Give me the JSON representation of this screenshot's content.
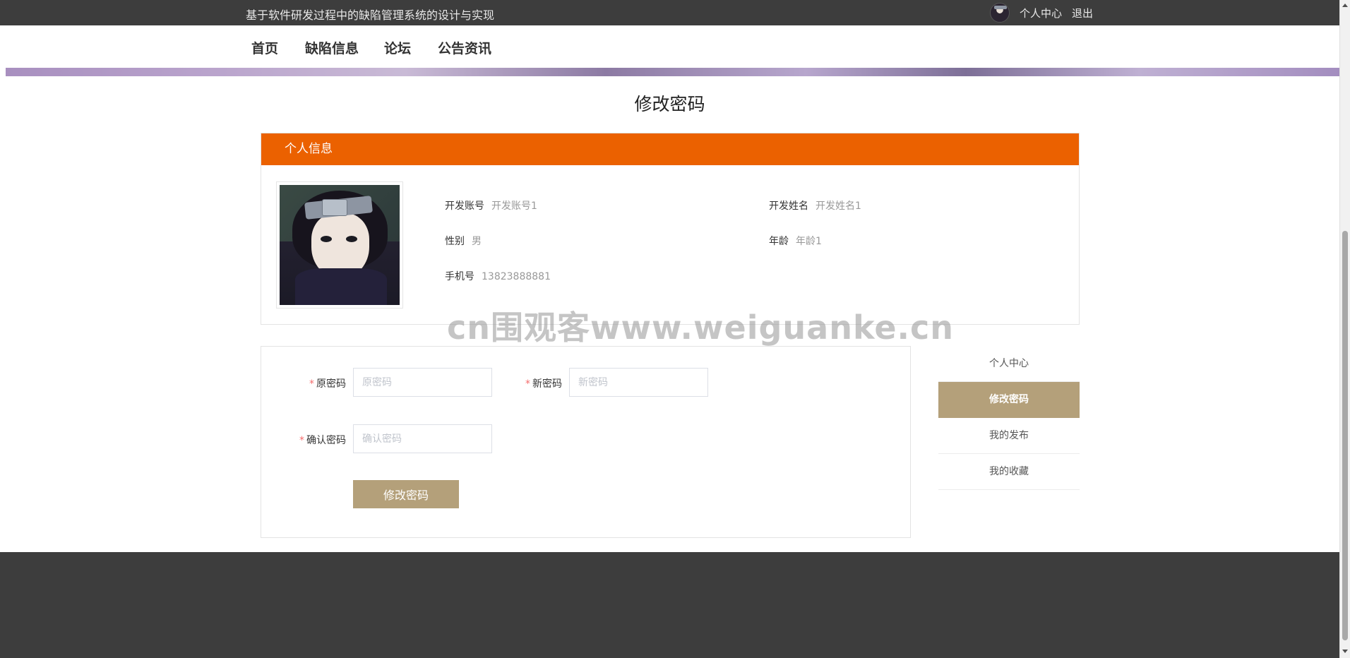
{
  "header": {
    "site_title": "基于软件研发过程中的缺陷管理系统的设计与实现",
    "user_center": "个人中心",
    "logout": "退出"
  },
  "nav": {
    "items": [
      {
        "label": "首页"
      },
      {
        "label": "缺陷信息"
      },
      {
        "label": "论坛"
      },
      {
        "label": "公告资讯"
      }
    ]
  },
  "page": {
    "title": "修改密码"
  },
  "profile": {
    "header": "个人信息",
    "account_label": "开发账号",
    "account_value": "开发账号1",
    "name_label": "开发姓名",
    "name_value": "开发姓名1",
    "gender_label": "性别",
    "gender_value": "男",
    "age_label": "年龄",
    "age_value": "年龄1",
    "phone_label": "手机号",
    "phone_value": "13823888881"
  },
  "form": {
    "required_mark": "*",
    "old_password_label": "原密码",
    "old_password_placeholder": "原密码",
    "old_password_value": "",
    "new_password_label": "新密码",
    "new_password_placeholder": "新密码",
    "new_password_value": "",
    "confirm_password_label": "确认密码",
    "confirm_password_placeholder": "确认密码",
    "confirm_password_value": "",
    "submit_label": "修改密码"
  },
  "side_menu": {
    "items": [
      {
        "label": "个人中心",
        "active": false
      },
      {
        "label": "修改密码",
        "active": true
      },
      {
        "label": "我的发布",
        "active": false
      },
      {
        "label": "我的收藏",
        "active": false
      }
    ]
  },
  "watermark": "cn围观客www.weiguanke.cn",
  "colors": {
    "topbar": "#3d3d3d",
    "accent_orange": "#eb6100",
    "accent_tan": "#b4a07a",
    "footer": "#3d3d3d"
  }
}
